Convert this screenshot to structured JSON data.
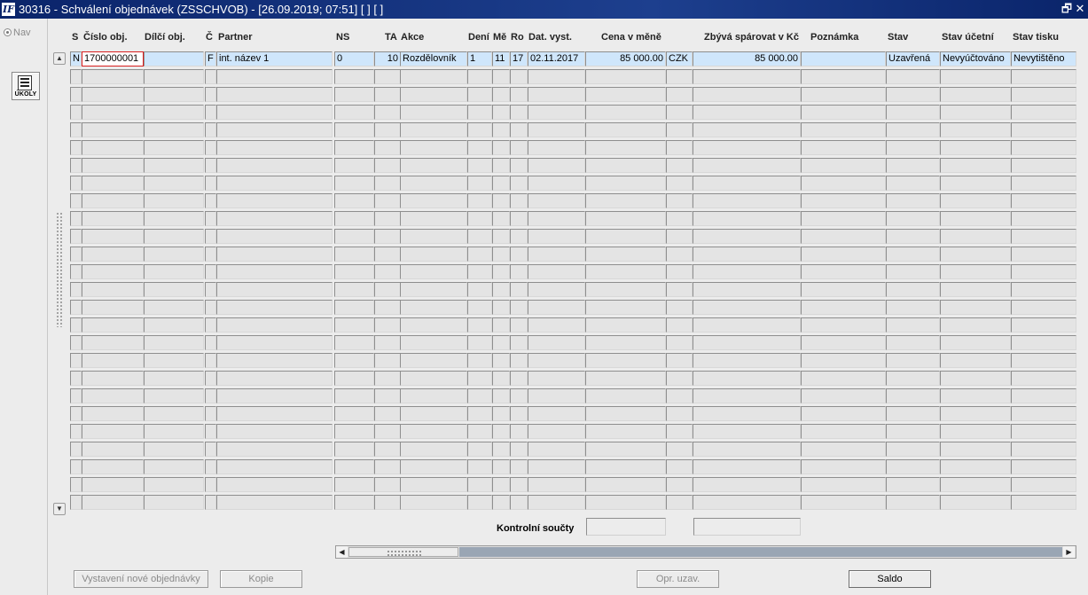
{
  "window": {
    "icon_text": "IF",
    "title": "30316 - Schválení objednávek (ZSSCHVOB) - [26.09.2019; 07:51]  [ ]  [ ]",
    "restore_glyph": "🗗",
    "close_glyph": "✕"
  },
  "sidebar": {
    "nav_label": "Nav",
    "tasks_button_label": "ÚKOLY"
  },
  "grid": {
    "headers": {
      "s": "S",
      "cislo_obj": "Číslo obj.",
      "dilci_obj": "Dílčí obj.",
      "c": "Č",
      "partner": "Partner",
      "ns": "NS",
      "ta": "TA",
      "akce": "Akce",
      "den": "Dení",
      "mesic": "Mě",
      "rok": "Ro",
      "dat_vyst": "Dat. vyst.",
      "cena_v_mene": "Cena v měně",
      "zbyva_sparovat": "Zbývá spárovat v Kč",
      "poznamka": "Poznámka",
      "stav": "Stav",
      "stav_ucetni": "Stav účetní",
      "stav_tisku": "Stav tisku"
    },
    "row": {
      "s": "N",
      "cislo_obj": "1700000001",
      "dilci_obj": "",
      "c": "F",
      "partner": "int. název 1",
      "ns": "0",
      "ta": "10",
      "akce": "Rozdělovník",
      "den": "1",
      "mesic": "11",
      "rok": "17",
      "dat_vyst": "02.11.2017",
      "cena_v_mene": "85 000.00",
      "mena": "CZK",
      "zbyva_sparovat": "85 000.00",
      "poznamka": "",
      "stav": "Uzavřená",
      "stav_ucetni": "Nevyúčtováno",
      "stav_tisku": "Nevytištěno"
    },
    "scroll_up_glyph": "▲",
    "scroll_down_glyph": "▼"
  },
  "footer": {
    "kontrolni_soucty_label": "Kontrolní součty",
    "scroll_left_glyph": "◀",
    "scroll_right_glyph": "▶"
  },
  "buttons": {
    "new_order": "Vystavení nové objednávky",
    "copy": "Kopie",
    "opr_uzav": "Opr. uzav.",
    "saldo": "Saldo"
  },
  "colors": {
    "titlebar": "#0a246a",
    "selected_row": "#cfe6fb",
    "focus_border": "#d81e1e"
  }
}
